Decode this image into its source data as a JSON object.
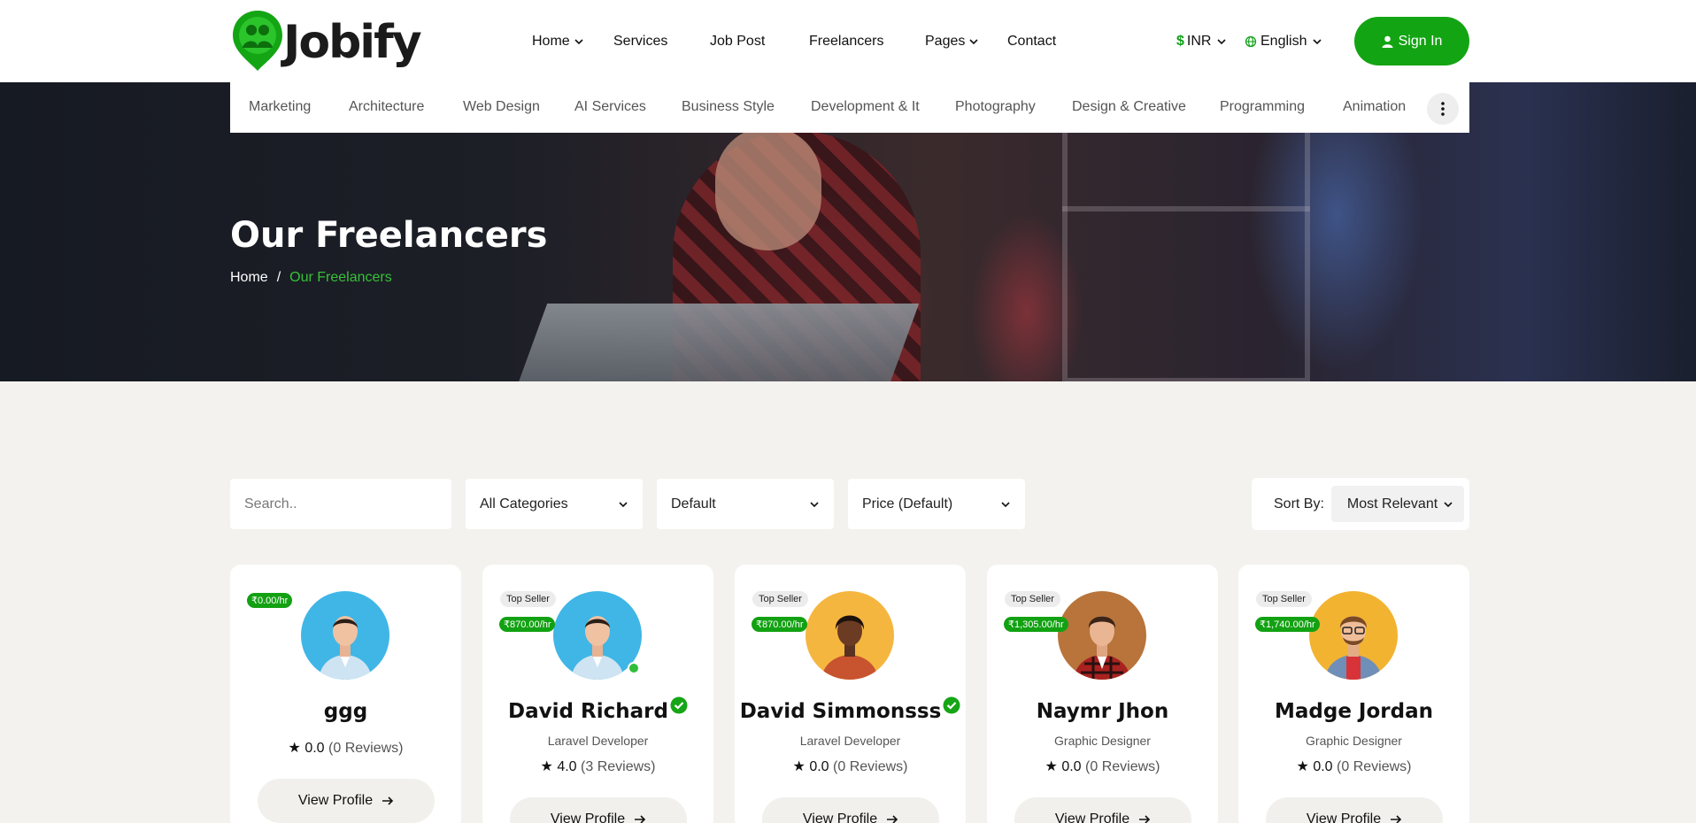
{
  "header": {
    "logo_text": "Jobify",
    "nav": [
      "Home",
      "Services",
      "Job Post",
      "Freelancers",
      "Pages",
      "Contact"
    ],
    "currency": "INR",
    "currency_symbol": "$",
    "language": "English",
    "signin_label": "Sign In"
  },
  "categories": [
    "Marketing",
    "Architecture",
    "Web Design",
    "AI Services",
    "Business Style",
    "Development & It",
    "Photography",
    "Design & Creative",
    "Programming",
    "Animation"
  ],
  "hero": {
    "title": "Our Freelancers",
    "breadcrumb_home": "Home",
    "breadcrumb_sep": "/",
    "breadcrumb_current": "Our Freelancers"
  },
  "filters": {
    "search_placeholder": "Search..",
    "category": "All Categories",
    "default": "Default",
    "price": "Price (Default)",
    "sort_label": "Sort By:",
    "sort_value": "Most Relevant"
  },
  "freelancers": [
    {
      "name": "ggg",
      "role": "",
      "rate": "₹0.00/hr",
      "rating": "0.0",
      "reviews": "(0 Reviews)",
      "button": "View Profile",
      "top_seller": "",
      "verified": false
    },
    {
      "name": "David Richard",
      "role": "Laravel Developer",
      "rate": "₹870.00/hr",
      "rating": "4.0",
      "reviews": "(3 Reviews)",
      "button": "View Profile",
      "top_seller": "Top Seller",
      "verified": true
    },
    {
      "name": "David Simmonsss",
      "role": "Laravel Developer",
      "rate": "₹870.00/hr",
      "rating": "0.0",
      "reviews": "(0 Reviews)",
      "button": "View Profile",
      "top_seller": "Top Seller",
      "verified": true
    },
    {
      "name": "Naymr Jhon",
      "role": "Graphic Designer",
      "rate": "₹1,305.00/hr",
      "rating": "0.0",
      "reviews": "(0 Reviews)",
      "button": "View Profile",
      "top_seller": "Top Seller",
      "verified": false
    },
    {
      "name": "Madge Jordan",
      "role": "Graphic Designer",
      "rate": "₹1,740.00/hr",
      "rating": "0.0",
      "reviews": "(0 Reviews)",
      "button": "View Profile",
      "top_seller": "Top Seller",
      "verified": false
    }
  ],
  "colors": {
    "accent": "#13a413",
    "background": "#f3f2ee"
  }
}
